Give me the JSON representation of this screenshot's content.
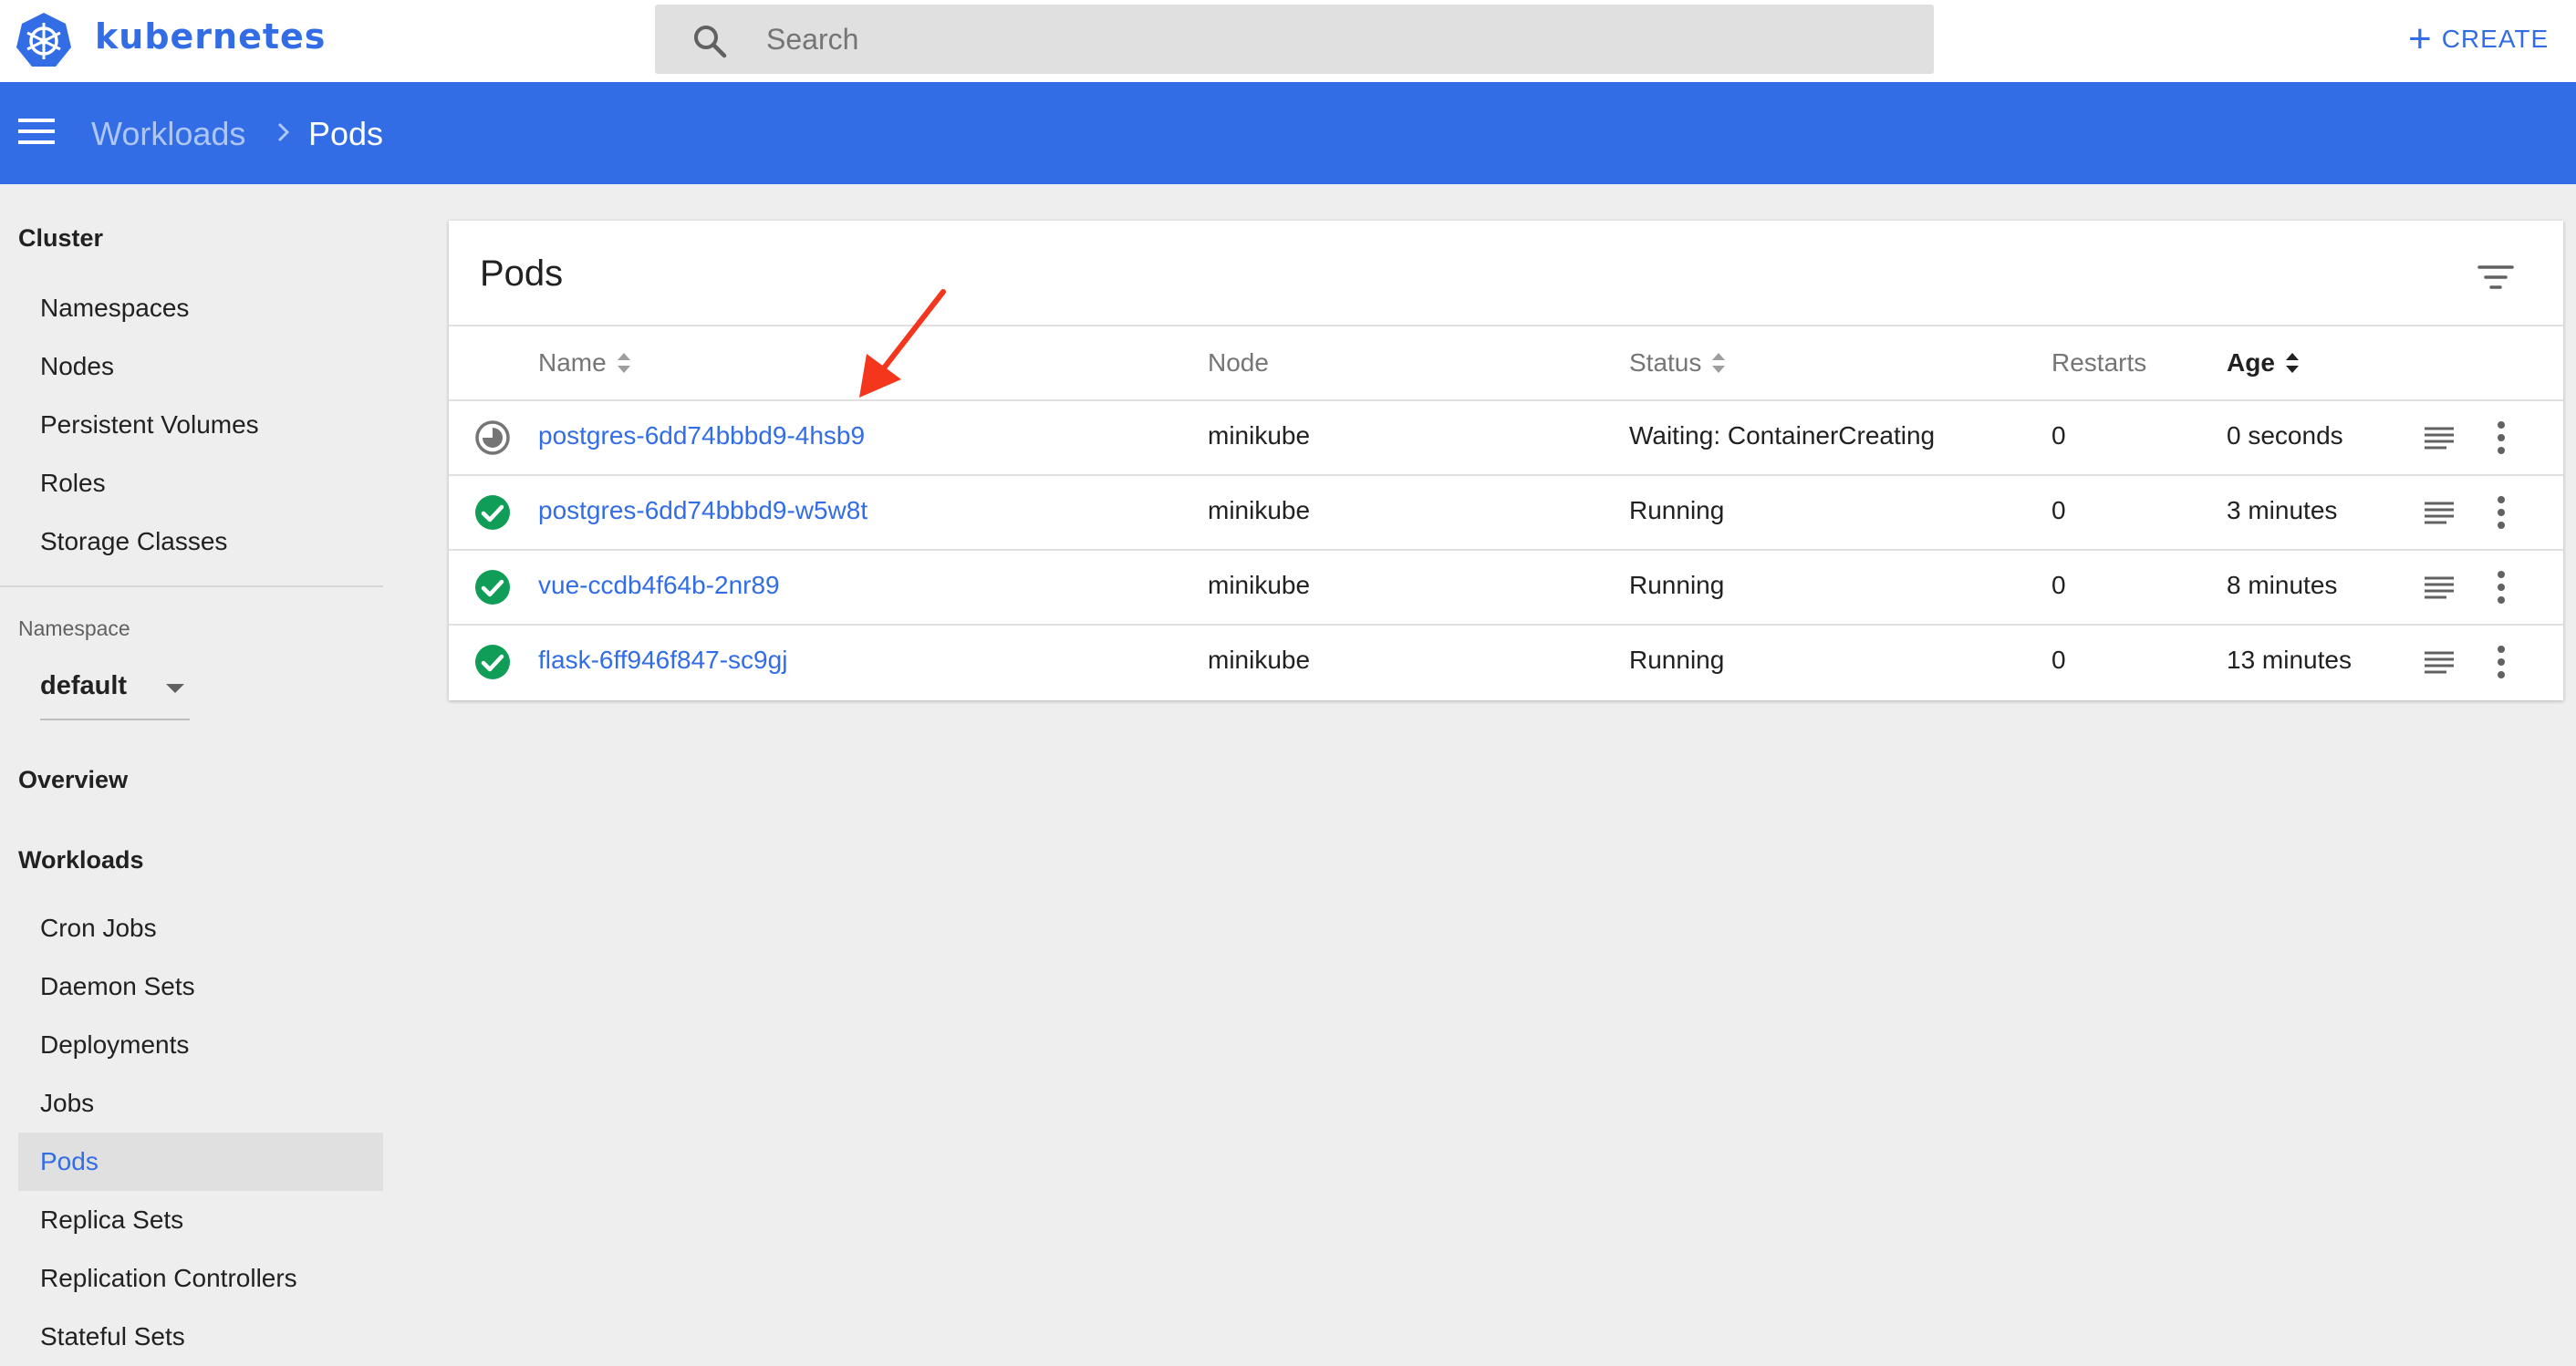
{
  "app": {
    "brand": "kubernetes",
    "search_placeholder": "Search",
    "create_label": "CREATE",
    "create_icon": "plus-icon"
  },
  "breadcrumb": {
    "parent": "Workloads",
    "current": "Pods"
  },
  "sidebar": {
    "cluster_heading": "Cluster",
    "cluster_items": [
      "Namespaces",
      "Nodes",
      "Persistent Volumes",
      "Roles",
      "Storage Classes"
    ],
    "namespace_label": "Namespace",
    "namespace_value": "default",
    "overview_heading": "Overview",
    "workloads_heading": "Workloads",
    "workload_items": [
      "Cron Jobs",
      "Daemon Sets",
      "Deployments",
      "Jobs",
      "Pods",
      "Replica Sets",
      "Replication Controllers",
      "Stateful Sets"
    ],
    "active_item": "Pods"
  },
  "card": {
    "title": "Pods",
    "columns": {
      "name": "Name",
      "node": "Node",
      "status": "Status",
      "restarts": "Restarts",
      "age": "Age"
    },
    "rows": [
      {
        "state": "pending",
        "name": "postgres-6dd74bbbd9-4hsb9",
        "node": "minikube",
        "status": "Waiting: ContainerCreating",
        "restarts": "0",
        "age": "0 seconds"
      },
      {
        "state": "ok",
        "name": "postgres-6dd74bbbd9-w5w8t",
        "node": "minikube",
        "status": "Running",
        "restarts": "0",
        "age": "3 minutes"
      },
      {
        "state": "ok",
        "name": "vue-ccdb4f64b-2nr89",
        "node": "minikube",
        "status": "Running",
        "restarts": "0",
        "age": "8 minutes"
      },
      {
        "state": "ok",
        "name": "flask-6ff946f847-sc9gj",
        "node": "minikube",
        "status": "Running",
        "restarts": "0",
        "age": "13 minutes"
      }
    ]
  },
  "colors": {
    "brand_blue": "#326de6",
    "running_green": "#0f9d58",
    "pending_grey": "#757575",
    "annotation_red": "#f4371c"
  }
}
